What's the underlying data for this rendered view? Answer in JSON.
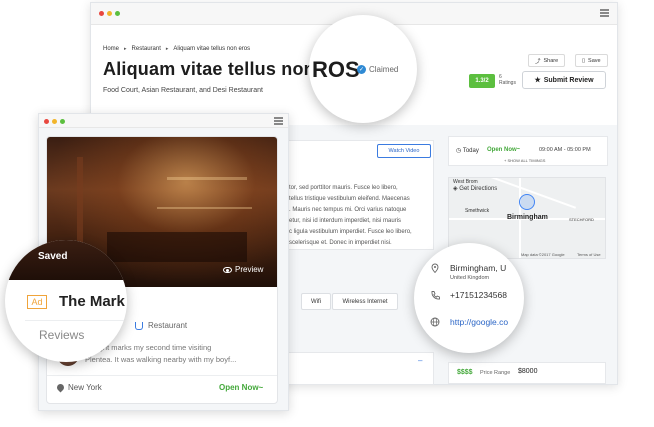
{
  "back_window": {
    "breadcrumb": [
      "Home",
      "Restaurant",
      "Aliquam vitae tellus non eros"
    ],
    "title": "Aliquam vitae tellus non",
    "subtitle": "Food Court, Asian Restaurant, and Desi Restaurant",
    "share_label": "Share",
    "save_label": "Save",
    "rating": "1.3/2",
    "ratings_count": "6",
    "ratings_label": "Ratings",
    "submit_review_label": "Submit Review",
    "watch_video_label": "Watch Video",
    "description_lines": [
      "tor, sed porttitor mauris. Fusce leo libero,",
      "tellus tristique vestibulum eleifend. Maecenas",
      ". Mauris nec tempus mi. Orci varius natoque",
      "etur, nisi id interdum imperdiet, nisi mauris",
      "c ligula vestibulum imperdiet. Fusce leo libero,",
      "scelerisque et. Donec in imperdiet nisi."
    ],
    "amenities": [
      "Wifi",
      "Wireless Internet"
    ],
    "hours": {
      "today_label": "Today",
      "open_now": "Open Now~",
      "time": "09:00 AM - 05:00 PM",
      "show_all": "+ SHOW ALL TIMINGS"
    },
    "map": {
      "get_directions": "Get Directions",
      "city": "Birmingham",
      "labels": [
        "West Brom",
        "Smethwick",
        "STECHFORD"
      ],
      "attribution": "Map data ©2017 Google",
      "terms": "Terms of Use"
    },
    "price": {
      "symbols": "$$$$",
      "label": "Price Range",
      "value": "$8000"
    }
  },
  "magnifier_title": {
    "text": "ros",
    "claimed_label": "Claimed"
  },
  "magnifier_contact": {
    "address": "Birmingham, U",
    "address_sub": "United Kingdom",
    "phone": "+17151234568",
    "website": "http://google.co"
  },
  "front_window": {
    "preview_label": "Preview",
    "category": "Restaurant",
    "review_lines": [
      "Tonight marks my second time visiting",
      "Plentea. It was walking nearby with my boyf..."
    ],
    "location": "New York",
    "open_now": "Open Now~"
  },
  "magnifier_hotel": {
    "saved_label": "Saved",
    "ad_label": "Ad",
    "hotel_name": "The Mark Hotel",
    "reviews_label": "Reviews"
  },
  "colors": {
    "accent_green": "#5cbf3f",
    "link_blue": "#2a65c6",
    "ad_orange": "#f0a43a"
  }
}
